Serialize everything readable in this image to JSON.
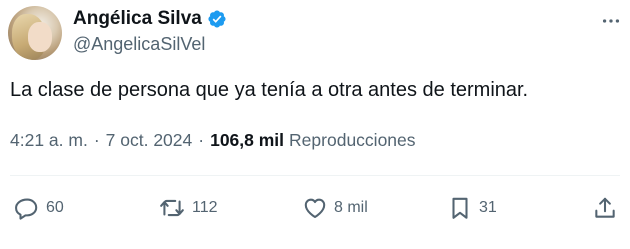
{
  "author": {
    "display_name": "Angélica Silva",
    "handle": "@AngelicaSilVel",
    "verified": true
  },
  "tweet": {
    "text": "La clase de persona que ya tenía a otra antes de terminar.",
    "time": "4:21 a. m.",
    "separator": "·",
    "date": "7 oct. 2024",
    "views_count": "106,8 mil",
    "views_label": "Reproducciones"
  },
  "actions": {
    "replies": "60",
    "reposts": "112",
    "likes": "8 mil",
    "bookmarks": "31"
  },
  "icons": {
    "verified": "verified-badge-icon",
    "more": "more-horizontal-icon",
    "reply": "reply-bubble-icon",
    "repost": "repost-icon",
    "like": "heart-icon",
    "bookmark": "bookmark-icon",
    "share": "share-icon"
  },
  "colors": {
    "text": "#0f1419",
    "secondary": "#536471",
    "verified": "#1d9bf0",
    "divider": "#eff3f4"
  }
}
